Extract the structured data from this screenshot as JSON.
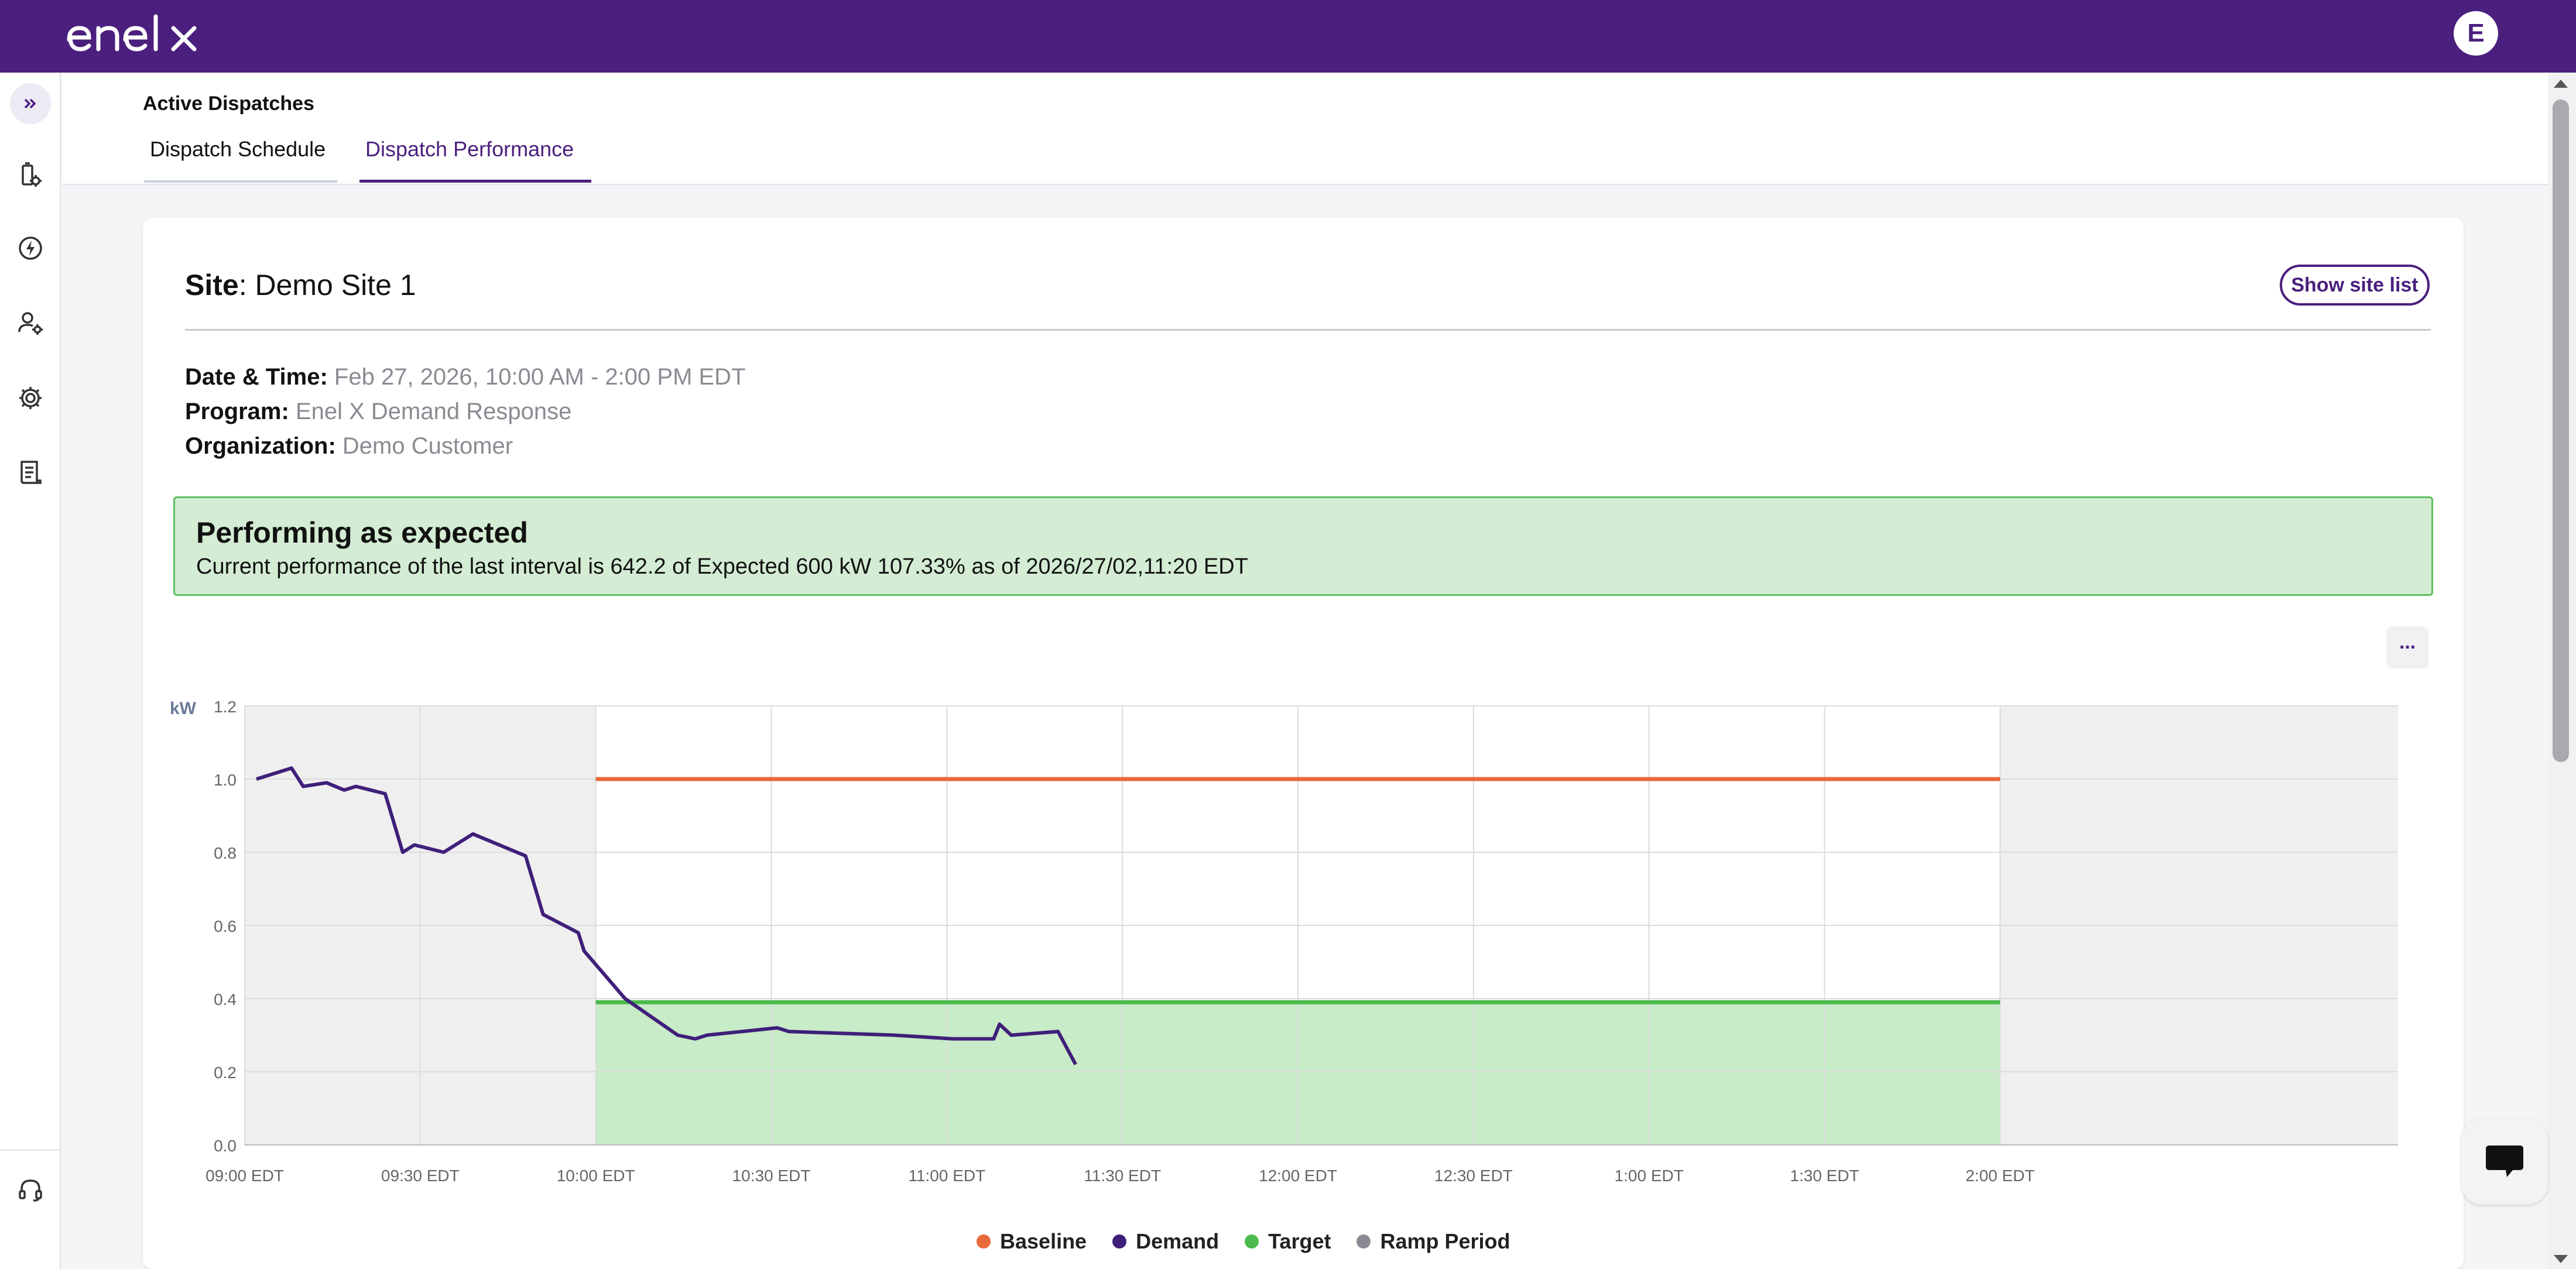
{
  "app": {
    "logo_text": "enel x",
    "avatar_initial": "E"
  },
  "header": {
    "page_title": "Active Dispatches",
    "tabs": [
      {
        "label": "Dispatch Schedule"
      },
      {
        "label": "Dispatch Performance",
        "active": true
      }
    ]
  },
  "card": {
    "site_label": "Site",
    "site_value": ": Demo Site 1",
    "show_site_list": "Show site list",
    "datetime_label": "Date & Time:",
    "datetime_value": "Feb 27, 2026, 10:00 AM - 2:00 PM EDT",
    "program_label": "Program:",
    "program_value": "Enel X Demand Response",
    "org_label": "Organization:",
    "org_value": "Demo Customer",
    "status_title": "Performing as expected",
    "status_text": "Current performance of the last interval is 642.2 of Expected 600 kW 107.33%  as of 2026/27/02,11:20 EDT",
    "menu_label": "···"
  },
  "colors": {
    "brand": "#4a1f7d",
    "baseline": "#e8693a",
    "demand": "#3f1f7a",
    "target": "#4cba4c",
    "ramp": "#8a8a92",
    "status_bg": "#d3ecd3"
  },
  "chart_data": {
    "type": "line",
    "ylabel": "kW",
    "ylim": [
      0,
      1.2
    ],
    "y_ticks": [
      "1.2",
      "1.0",
      "0.8",
      "0.6",
      "0.4",
      "0.2",
      "0.0"
    ],
    "x_ticks": [
      "09:00 EDT",
      "09:30 EDT",
      "10:00 EDT",
      "10:30 EDT",
      "11:00 EDT",
      "11:30 EDT",
      "12:00 EDT",
      "12:30 EDT",
      "1:00 EDT",
      "1:30 EDT",
      "2:00 EDT"
    ],
    "ramp_periods": [
      {
        "from": "09:00 EDT",
        "to": "10:00 EDT"
      },
      {
        "from": "2:00 EDT",
        "to": "2:20 EDT"
      }
    ],
    "series": [
      {
        "name": "Baseline",
        "color": "#e8693a",
        "x_min": [
          60,
          300
        ],
        "y": [
          1.0,
          1.0
        ]
      },
      {
        "name": "Target",
        "color": "#4cba4c",
        "x_min": [
          60,
          300
        ],
        "y": [
          0.39,
          0.39
        ]
      },
      {
        "name": "Demand",
        "color": "#3f1f7a",
        "x_min": [
          2,
          8,
          10,
          14,
          17,
          19,
          24,
          27,
          29,
          34,
          39,
          48,
          51,
          57,
          58,
          65,
          74,
          77,
          79,
          91,
          93,
          111,
          121,
          128,
          129,
          131,
          139,
          142
        ],
        "y": [
          1.0,
          1.03,
          0.98,
          0.99,
          0.97,
          0.98,
          0.96,
          0.8,
          0.82,
          0.8,
          0.85,
          0.79,
          0.63,
          0.58,
          0.53,
          0.4,
          0.3,
          0.29,
          0.3,
          0.32,
          0.31,
          0.3,
          0.29,
          0.29,
          0.33,
          0.3,
          0.31,
          0.22
        ]
      }
    ],
    "legend": [
      "Baseline",
      "Demand",
      "Target",
      "Ramp Period"
    ],
    "legend_position": "bottom-center"
  }
}
